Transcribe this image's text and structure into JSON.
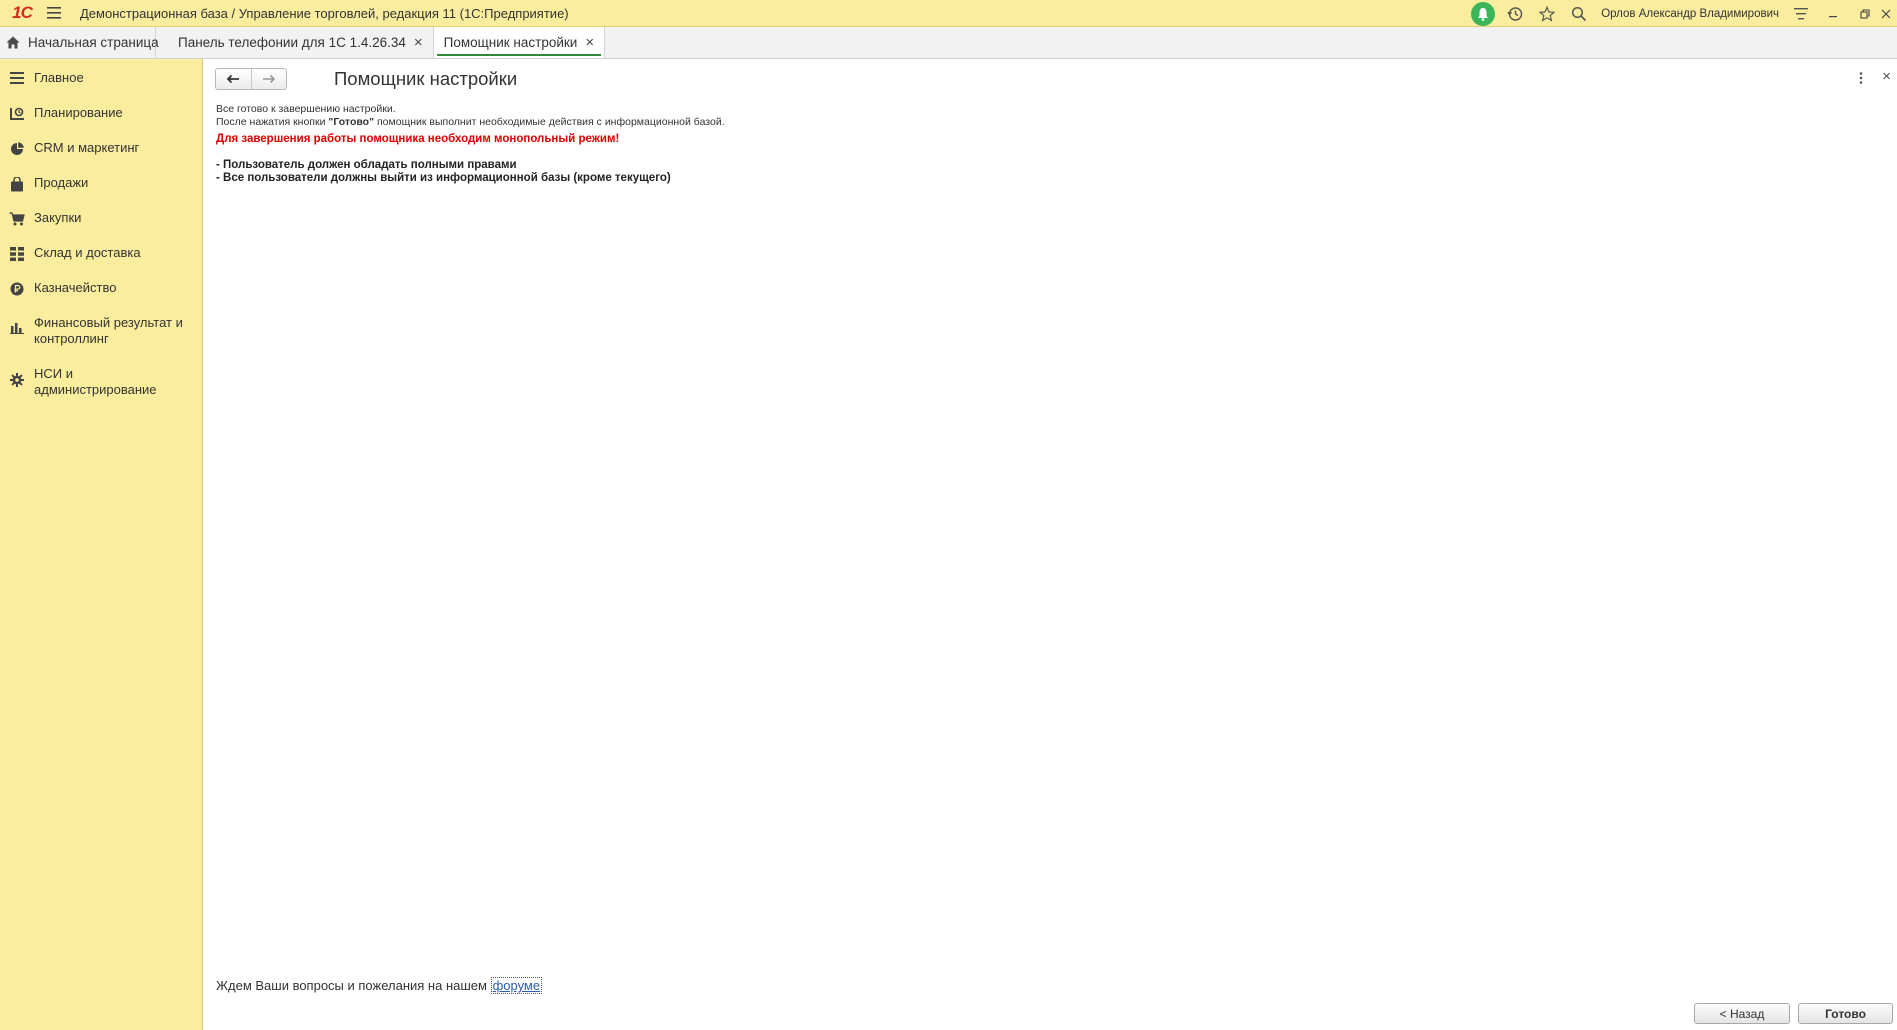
{
  "titlebar": {
    "logo": "1С",
    "title": "Демонстрационная база / Управление торговлей, редакция 11  (1С:Предприятие)",
    "user": "Орлов Александр Владимирович",
    "icons": [
      "menu-icon",
      "bell-icon",
      "history-icon",
      "star-icon",
      "search-icon",
      "settings-icon",
      "minimize-icon",
      "restore-icon",
      "close-icon"
    ]
  },
  "tabs": [
    {
      "label": "Начальная страница",
      "icon": "home-icon"
    },
    {
      "label": "Панель телефонии для 1С 1.4.26.34",
      "closable": true
    },
    {
      "label": "Помощник настройки",
      "closable": true,
      "active": true
    }
  ],
  "sidebar": {
    "items": [
      {
        "label": "Главное",
        "icon": "list-icon"
      },
      {
        "label": "Планирование",
        "icon": "planning-icon"
      },
      {
        "label": "CRM и маркетинг",
        "icon": "pie-icon"
      },
      {
        "label": "Продажи",
        "icon": "bag-icon"
      },
      {
        "label": "Закупки",
        "icon": "cart-icon"
      },
      {
        "label": "Склад и доставка",
        "icon": "grid-icon"
      },
      {
        "label": "Казначейство",
        "icon": "ruble-icon"
      },
      {
        "label": "Финансовый результат и контроллинг",
        "icon": "chart-icon"
      },
      {
        "label": "НСИ и администрирование",
        "icon": "gear-icon"
      }
    ]
  },
  "main": {
    "title": "Помощник настройки",
    "line1": "Все готово к завершению настройки.",
    "line2_pre": "После нажатия кнопки ",
    "line2_bold": "\"Готово\"",
    "line2_post": " помощник выполнит необходимые действия с информационной базой.",
    "warning": "Для завершения работы помощника необходим монопольный режим!",
    "req1": "- Пользователь должен обладать полными правами",
    "req2": "- Все пользователи должны выйти из информационной базы (кроме текущего)",
    "footer_text": "Ждем Ваши вопросы и пожелания на нашем ",
    "footer_link": "форуме",
    "back_button": "< Назад",
    "done_button": "Готово"
  },
  "colors": {
    "accent_yellow": "#fbed9e",
    "warning_red": "#dd0000",
    "active_tab_underline": "#2e8b3a",
    "bell_green": "#3cb55a"
  }
}
